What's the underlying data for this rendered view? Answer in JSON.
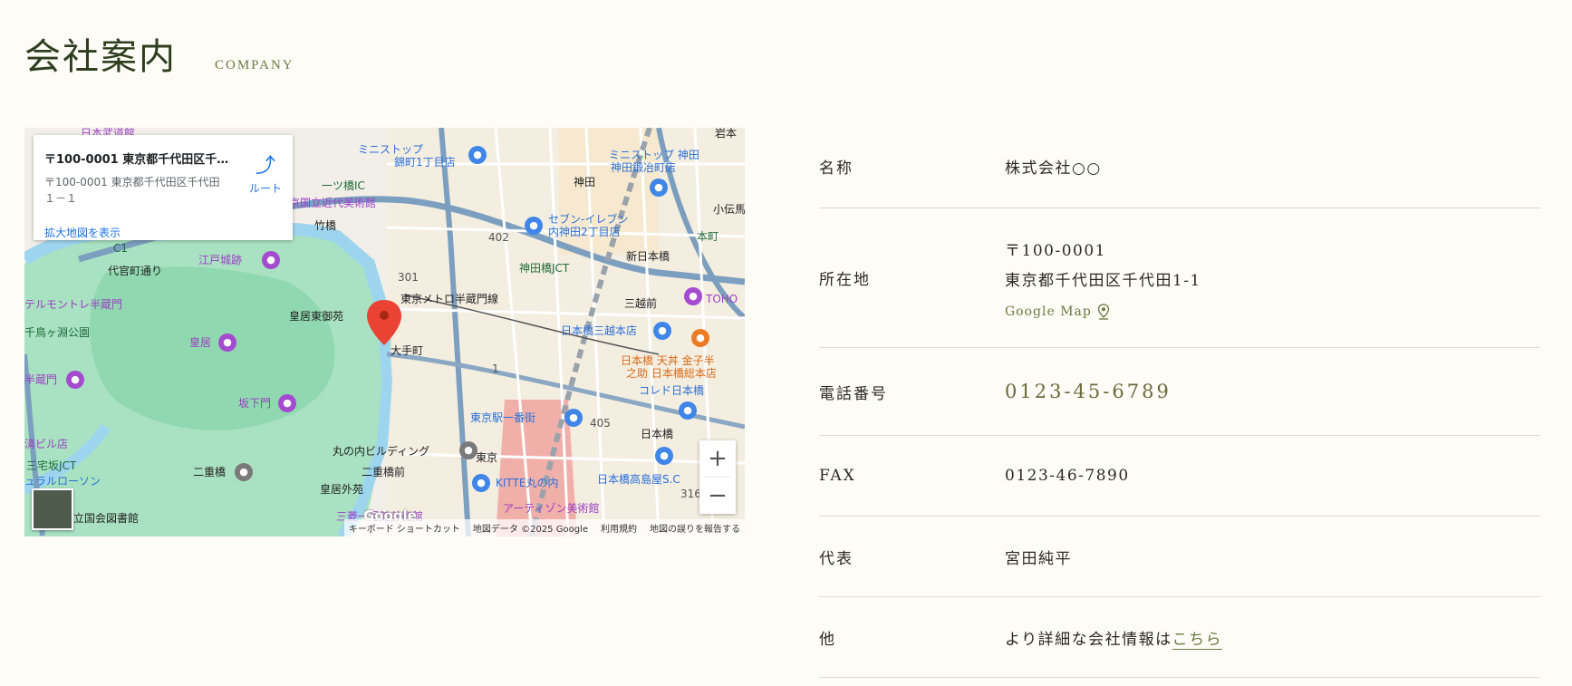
{
  "header": {
    "title": "会社案内",
    "subtitle": "COMPANY"
  },
  "map": {
    "infowindow": {
      "title": "〒100-0001 東京都千代田区千...",
      "address": "〒100-0001 東京都千代田区千代田１－１",
      "route_label": "ルート",
      "enlarge_label": "拡大地図を表示"
    },
    "zoom_in": "+",
    "zoom_out": "−",
    "google_logo": "Google",
    "attribution": [
      "キーボード ショートカット",
      "地図データ ©2025 Google",
      "利用規約",
      "地図の誤りを報告する"
    ],
    "labels": {
      "l1": "日本武道館",
      "l2": "ミニストップ",
      "l3": "錦町1丁目店",
      "l4": "ミニストップ 神田",
      "l5": "神田鍛冶町店",
      "l6": "京国立近代美術館",
      "l7": "竹橋",
      "l8": "一ツ橋IC",
      "l9": "セブン-イレブン",
      "l10": "内神田2丁目店",
      "l11": "神田",
      "l12": "小伝馬",
      "l13": "江戸城跡",
      "l14": "代官町通り",
      "l15": "神田橋JCT",
      "l16": "新日本橋",
      "l17": "本町",
      "l18": "テルモントレ半蔵門",
      "l19": "皇居東御苑",
      "l20": "東京メトロ半蔵門線",
      "l21": "三越前",
      "l22": "TOHO",
      "l23": "千鳥ヶ淵公園",
      "l24": "皇居",
      "l25": "大手町",
      "l26": "日本橋三越本店",
      "l27": "日本橋 天丼 金子半",
      "l28": "之助 日本橋総本店",
      "l29": "半蔵門",
      "l30": "坂下門",
      "l31": "コレド日本橋",
      "l32": "東京駅一番街",
      "l33": "日本橋",
      "l34": "済ビル店",
      "l35": "丸の内ビルディング",
      "l36": "東京",
      "l37": "二重橋",
      "l38": "二重橋前",
      "l39": "三宅坂JCT",
      "l40": "日本橋高島屋S.C",
      "l41": "ュラルローソン",
      "l42": "KITTE丸の内",
      "l43": "皇居外苑",
      "l44": "立国会図書館",
      "l45": "三菱一号館美術館",
      "l46": "アーティゾン美術館",
      "l47": "岩本",
      "l48": "402",
      "l49": "301",
      "l50": "405",
      "l51": "316",
      "l52": "C1",
      "l53": "1"
    }
  },
  "info": {
    "name_label": "名称",
    "name_value": "株式会社○○",
    "address_label": "所在地",
    "postal": "〒100-0001",
    "address": "東京都千代田区千代田1-1",
    "gmap_link": "Google Map",
    "phone_label": "電話番号",
    "phone_value": "0123-45-6789",
    "fax_label": "FAX",
    "fax_value": "0123-46-7890",
    "rep_label": "代表",
    "rep_value": "宮田純平",
    "other_label": "他",
    "other_text": "より詳細な会社情報は",
    "other_link": "こちら"
  },
  "colors": {
    "accent": "#6b7a3f",
    "title": "#2f3e1e",
    "background": "#fdfcf7"
  }
}
